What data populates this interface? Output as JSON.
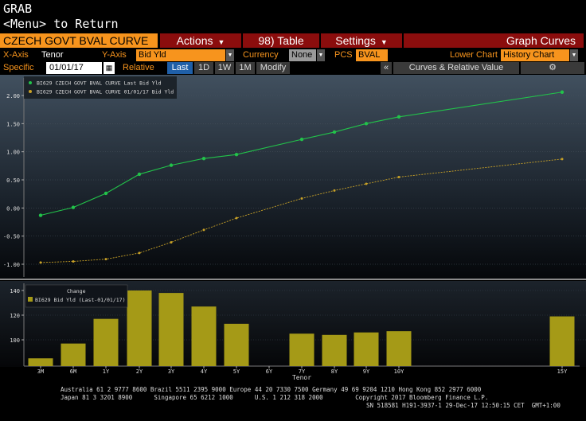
{
  "header": {
    "title": "GRAB",
    "subtitle": "<Menu> to Return"
  },
  "toolbar": {
    "security": "CZECH GOVT BVAL CURVE",
    "actions": "Actions",
    "table_num": "98)",
    "table": "Table",
    "settings": "Settings",
    "graph_curves": "Graph Curves"
  },
  "params": {
    "xaxis_label": "X-Axis",
    "xaxis_value": "Tenor",
    "yaxis_label": "Y-Axis",
    "yaxis_value": "Bid Yld",
    "currency_label": "Currency",
    "currency_value": "None",
    "pcs_label": "PCS",
    "pcs_value": "BVAL",
    "lower_label": "Lower Chart",
    "lower_value": "History Chart"
  },
  "specific": {
    "label": "Specific",
    "date": "01/01/17",
    "relative": "Relative",
    "tabs": [
      "Last",
      "1D",
      "1W",
      "1M"
    ],
    "modify": "Modify",
    "collapse": "«",
    "curves_rv": "Curves & Relative Value",
    "gear": "⚙"
  },
  "colors": {
    "accent": "#f7941d",
    "button_red": "#8b0d0d",
    "series_last": "#22c34a",
    "series_hist": "#c9a227",
    "bars": "#a59a17"
  },
  "chart_data": [
    {
      "type": "line",
      "categories": [
        "3M",
        "6M",
        "1Y",
        "2Y",
        "3Y",
        "4Y",
        "5Y",
        "6Y",
        "7Y",
        "8Y",
        "9Y",
        "10Y",
        "15Y"
      ],
      "series": [
        {
          "name": "BI629 CZECH GOVT BVAL CURVE Last Bid Yld",
          "values": [
            -0.13,
            0.01,
            0.26,
            0.6,
            0.76,
            0.88,
            0.95,
            null,
            1.22,
            1.35,
            1.5,
            1.62,
            2.06
          ]
        },
        {
          "name": "BI629 CZECH GOVT BVAL CURVE 01/01/17 Bid Yld",
          "values": [
            -0.97,
            -0.95,
            -0.91,
            -0.8,
            -0.61,
            -0.39,
            -0.18,
            null,
            0.17,
            0.31,
            0.43,
            0.55,
            0.87
          ]
        }
      ],
      "yticks": [
        "2.00",
        "1.50",
        "1.00",
        "0.50",
        "0.00",
        "-0.50",
        "-1.00"
      ],
      "ylim": [
        -1.1,
        2.2
      ]
    },
    {
      "type": "bar",
      "legend_title": "Change",
      "legend_item": "BI629 Bid Yld (Last-01/01/17)",
      "categories": [
        "3M",
        "6M",
        "1Y",
        "2Y",
        "3Y",
        "4Y",
        "5Y",
        "6Y",
        "7Y",
        "8Y",
        "9Y",
        "10Y",
        "15Y"
      ],
      "values": [
        85,
        97,
        117,
        140,
        138,
        127,
        113,
        null,
        105,
        104,
        106,
        107,
        119
      ],
      "yticks": [
        "140",
        "120",
        "100"
      ],
      "ylim": [
        80,
        145
      ],
      "xlabel": "Tenor"
    }
  ],
  "footer": {
    "line1": "Australia 61 2 9777 8600 Brazil 5511 2395 9000 Europe 44 20 7330 7500 Germany 49 69 9204 1210 Hong Kong 852 2977 6000",
    "line2": "Japan 81 3 3201 8900      Singapore 65 6212 1000      U.S. 1 212 318 2000         Copyright 2017 Bloomberg Finance L.P.",
    "line3": "SN 518581 H191-3937-1 29-Dec-17 12:50:15 CET  GMT+1:00"
  }
}
